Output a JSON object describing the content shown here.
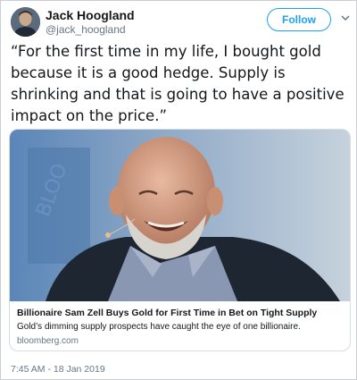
{
  "author": {
    "name": "Jack Hoogland",
    "handle": "@jack_hoogland",
    "avatar_icon": "profile-photo"
  },
  "follow_button": {
    "label": "Follow",
    "color": "#1da1f2"
  },
  "menu": {
    "icon": "chevron-down-icon"
  },
  "tweet": {
    "text": "“For the first time in my life, I bought gold because it is a good hedge. Supply is shrinking and that is going to have a positive impact on the price.”"
  },
  "card": {
    "image_icon": "smiling-man-photo",
    "title": "Billionaire Sam Zell Buys Gold for First Time in Bet on Tight Supply",
    "description": "Gold’s dimming supply prospects have caught the eye of one billionaire.",
    "domain": "bloomberg.com"
  },
  "timestamp": "7:45 AM - 18 Jan 2019",
  "colors": {
    "link_blue": "#1da1f2",
    "secondary_text": "#657786",
    "border": "#c9cfd4"
  }
}
